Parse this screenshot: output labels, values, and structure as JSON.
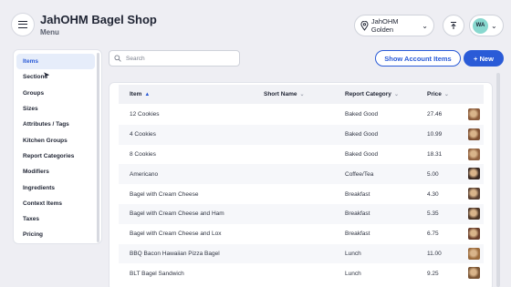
{
  "header": {
    "title": "JahOHM Bagel Shop",
    "subtitle": "Menu",
    "location": "JahOHM Golden",
    "user_initials": "WA"
  },
  "sidebar": {
    "items": [
      {
        "label": "Items",
        "active": true
      },
      {
        "label": "Sections"
      },
      {
        "label": "Groups"
      },
      {
        "label": "Sizes"
      },
      {
        "label": "Attributes / Tags"
      },
      {
        "label": "Kitchen Groups"
      },
      {
        "label": "Report Categories"
      },
      {
        "label": "Modifiers"
      },
      {
        "label": "Ingredients"
      },
      {
        "label": "Context Items"
      },
      {
        "label": "Taxes"
      },
      {
        "label": "Pricing"
      }
    ]
  },
  "toolbar": {
    "search_placeholder": "Search",
    "show_accounts_label": "Show Account Items",
    "new_label": "+ New"
  },
  "table": {
    "columns": {
      "item": "Item",
      "short_name": "Short Name",
      "category": "Report Category",
      "price": "Price"
    },
    "rows": [
      {
        "item": "12 Cookies",
        "category": "Baked Good",
        "price": "27.46",
        "thumb": "#8a5a3a"
      },
      {
        "item": "4 Cookies",
        "category": "Baked Good",
        "price": "10.99",
        "thumb": "#7d4f31"
      },
      {
        "item": "8 Cookies",
        "category": "Baked Good",
        "price": "18.31",
        "thumb": "#8f603f"
      },
      {
        "item": "Americano",
        "category": "Coffee/Tea",
        "price": "5.00",
        "thumb": "#3b2a22"
      },
      {
        "item": "Bagel with Cream Cheese",
        "category": "Breakfast",
        "price": "4.30",
        "thumb": "#5a4031"
      },
      {
        "item": "Bagel with Cream Cheese and Ham",
        "category": "Breakfast",
        "price": "5.35",
        "thumb": "#4e3626"
      },
      {
        "item": "Bagel with Cream Cheese and Lox",
        "category": "Breakfast",
        "price": "6.75",
        "thumb": "#6a3f2c"
      },
      {
        "item": "BBQ Bacon Hawaiian Pizza Bagel",
        "category": "Lunch",
        "price": "11.00",
        "thumb": "#9a6a3c"
      },
      {
        "item": "BLT Bagel Sandwich",
        "category": "Lunch",
        "price": "9.25",
        "thumb": "#7a5535"
      }
    ]
  },
  "colors": {
    "accent": "#2a5bd7",
    "avatar": "#88d8cf",
    "background": "#eeeef3"
  }
}
